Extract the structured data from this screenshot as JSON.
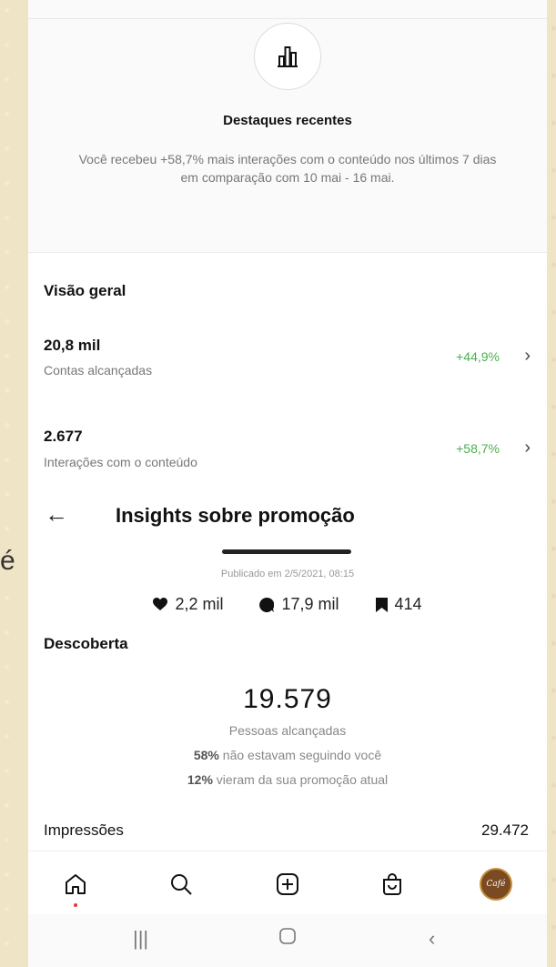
{
  "side_glyph": "é",
  "highlight": {
    "title": "Destaques recentes",
    "text": "Você recebeu +58,7% mais interações com o conteúdo nos últimos 7 dias em comparação com 10 mai - 16 mai."
  },
  "overview": {
    "title": "Visão geral",
    "metrics": [
      {
        "value": "20,8 mil",
        "label": "Contas alcançadas",
        "change": "+44,9%"
      },
      {
        "value": "2.677",
        "label": "Interações com o conteúdo",
        "change": "+58,7%"
      }
    ]
  },
  "insights": {
    "title": "Insights sobre promoção",
    "published": "Publicado em 2/5/2021, 08:15",
    "stats": {
      "likes": "2,2 mil",
      "comments": "17,9 mil",
      "saves": "414"
    }
  },
  "discovery": {
    "title": "Descoberta",
    "reach_value": "19.579",
    "reach_label": "Pessoas alcançadas",
    "not_following_pct": "58%",
    "not_following_text": "não estavam seguindo você",
    "from_promo_pct": "12%",
    "from_promo_text": "vieram da sua promoção atual",
    "impressions_label": "Impressões",
    "impressions_value": "29.472"
  },
  "nav": {
    "icons": [
      "home-icon",
      "search-icon",
      "add-post-icon",
      "shop-icon",
      "profile-avatar"
    ],
    "avatar_text": "Café"
  },
  "colors": {
    "positive": "#4caf50",
    "background": "#efe4c6"
  }
}
